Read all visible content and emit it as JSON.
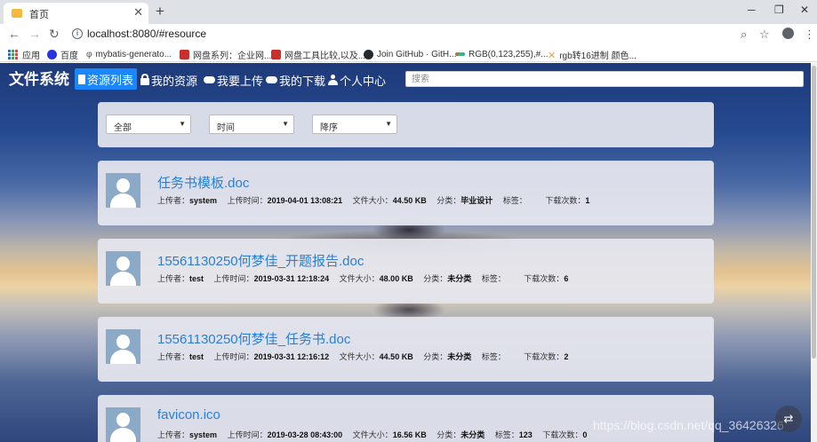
{
  "browser": {
    "tab_title": "首页",
    "url": "localhost:8080/#resource",
    "bookmarks": [
      {
        "label": "应用",
        "color": "#1a73e8"
      },
      {
        "label": "百度",
        "color": "#2932e1"
      },
      {
        "label": "mybatis-generato...",
        "color": "#555555"
      },
      {
        "label": "网盘系列：企业网...",
        "color": "#c9302c"
      },
      {
        "label": "网盘工具比较,以及...",
        "color": "#c9302c"
      },
      {
        "label": "Join GitHub · GitH...",
        "color": "#24292e"
      },
      {
        "label": "RGB(0,123,255),#...",
        "color": "#888888"
      },
      {
        "label": "rgb转16进制 颜色...",
        "color": "#e8a33b"
      }
    ]
  },
  "navbar": {
    "brand": "文件系统",
    "items": [
      {
        "label": "资源列表",
        "icon": "document-icon"
      },
      {
        "label": "我的资源",
        "icon": "lock-icon"
      },
      {
        "label": "我要上传",
        "icon": "cloud-upload-icon"
      },
      {
        "label": "我的下载",
        "icon": "cloud-download-icon"
      },
      {
        "label": "个人中心",
        "icon": "user-icon"
      }
    ],
    "search_placeholder": "搜索"
  },
  "filters": {
    "category": "全部",
    "sort_field": "时间",
    "order": "降序"
  },
  "meta_labels": {
    "uploader": "上传者：",
    "upload_time": "上传时间：",
    "file_size": "文件大小：",
    "category": "分类：",
    "tags": "标签：",
    "downloads": "下载次数："
  },
  "resources": [
    {
      "name": "任务书模板.doc",
      "uploader": "system",
      "time": "2019-04-01 13:08:21",
      "size": "44.50 KB",
      "category": "毕业设计",
      "tags": "",
      "downloads": "1"
    },
    {
      "name": "15561130250何梦佳_开题报告.doc",
      "uploader": "test",
      "time": "2019-03-31 12:18:24",
      "size": "48.00 KB",
      "category": "未分类",
      "tags": "",
      "downloads": "6"
    },
    {
      "name": "15561130250何梦佳_任务书.doc",
      "uploader": "test",
      "time": "2019-03-31 12:16:12",
      "size": "44.50 KB",
      "category": "未分类",
      "tags": "",
      "downloads": "2"
    },
    {
      "name": "favicon.ico",
      "uploader": "system",
      "time": "2019-03-28 08:43:00",
      "size": "16.56 KB",
      "category": "未分类",
      "tags": "123",
      "downloads": "0"
    }
  ],
  "watermark": "https://blog.csdn.net/qq_36426326",
  "colors": {
    "accent": "#1a87ff",
    "link": "#2a7fd4"
  }
}
